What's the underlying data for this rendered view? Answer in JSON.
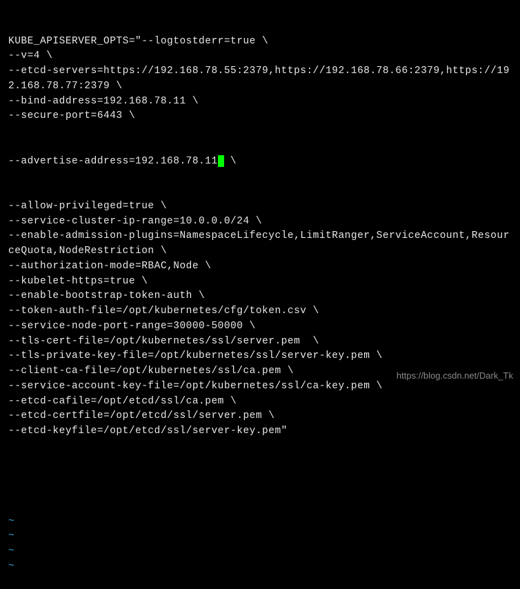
{
  "terminal": {
    "lines": [
      "KUBE_APISERVER_OPTS=\"--logtostderr=true \\",
      "--v=4 \\",
      "--etcd-servers=https://192.168.78.55:2379,https://192.168.78.66:2379,https://192.168.78.77:2379 \\",
      "--bind-address=192.168.78.11 \\",
      "--secure-port=6443 \\"
    ],
    "cursor_line_before": "--advertise-address=192.168.78.11",
    "cursor_line_after": " \\",
    "lines_after": [
      "--allow-privileged=true \\",
      "--service-cluster-ip-range=10.0.0.0/24 \\",
      "--enable-admission-plugins=NamespaceLifecycle,LimitRanger,ServiceAccount,ResourceQuota,NodeRestriction \\",
      "--authorization-mode=RBAC,Node \\",
      "--kubelet-https=true \\",
      "--enable-bootstrap-token-auth \\",
      "--token-auth-file=/opt/kubernetes/cfg/token.csv \\",
      "--service-node-port-range=30000-50000 \\",
      "--tls-cert-file=/opt/kubernetes/ssl/server.pem  \\",
      "--tls-private-key-file=/opt/kubernetes/ssl/server-key.pem \\",
      "--client-ca-file=/opt/kubernetes/ssl/ca.pem \\",
      "--service-account-key-file=/opt/kubernetes/ssl/ca-key.pem \\",
      "--etcd-cafile=/opt/etcd/ssl/ca.pem \\",
      "--etcd-certfile=/opt/etcd/ssl/server.pem \\",
      "--etcd-keyfile=/opt/etcd/ssl/server-key.pem\""
    ],
    "tilde_count": 4,
    "tilde_char": "~"
  },
  "watermark": "https://blog.csdn.net/Dark_Tk"
}
